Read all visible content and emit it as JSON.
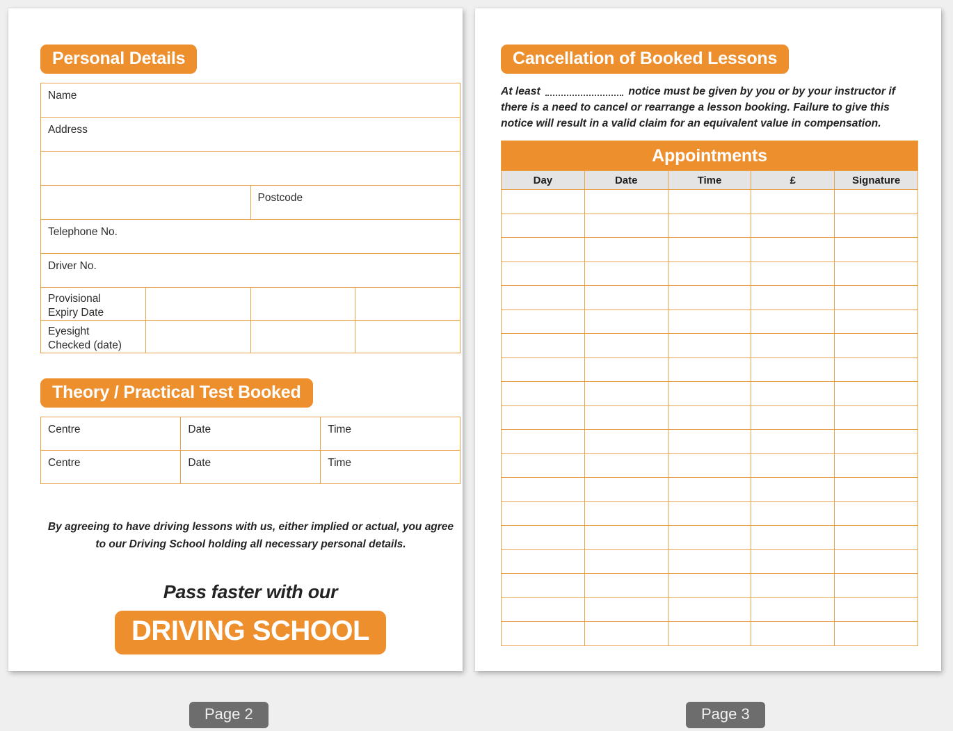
{
  "page_left": {
    "personal_details": {
      "heading": "Personal Details",
      "rows": {
        "name": "Name",
        "address": "Address",
        "postcode": "Postcode",
        "telephone": "Telephone No.",
        "driver_no": "Driver No.",
        "provisional_expiry": "Provisional\nExpiry Date",
        "provisional_expiry_line1": "Provisional",
        "provisional_expiry_line2": "Expiry Date",
        "eyesight_line1": "Eyesight",
        "eyesight_line2": "Checked (date)"
      }
    },
    "theory_test": {
      "heading": "Theory / Practical Test Booked",
      "columns": [
        "Centre",
        "Date",
        "Time"
      ],
      "rows": [
        [
          "Centre",
          "Date",
          "Time"
        ],
        [
          "Centre",
          "Date",
          "Time"
        ]
      ]
    },
    "consent_text": "By agreeing to have driving lessons with us, either implied or actual, you agree to our Driving School holding all necessary personal details.",
    "promo_line": "Pass faster with our",
    "brand_banner": "DRIVING SCHOOL"
  },
  "page_right": {
    "cancellation": {
      "heading": "Cancellation of Booked Lessons",
      "text_before_blank": "At least",
      "text_after_blank": "notice must be given by you or by your instructor if there is a need to cancel or rearrange a lesson booking. Failure to give this notice will result in a valid claim for an equivalent value in compensation."
    },
    "appointments": {
      "title": "Appointments",
      "columns": [
        "Day",
        "Date",
        "Time",
        "£",
        "Signature"
      ],
      "row_count": 19,
      "rows": [
        [
          "",
          "",
          "",
          "",
          ""
        ],
        [
          "",
          "",
          "",
          "",
          ""
        ],
        [
          "",
          "",
          "",
          "",
          ""
        ],
        [
          "",
          "",
          "",
          "",
          ""
        ],
        [
          "",
          "",
          "",
          "",
          ""
        ],
        [
          "",
          "",
          "",
          "",
          ""
        ],
        [
          "",
          "",
          "",
          "",
          ""
        ],
        [
          "",
          "",
          "",
          "",
          ""
        ],
        [
          "",
          "",
          "",
          "",
          ""
        ],
        [
          "",
          "",
          "",
          "",
          ""
        ],
        [
          "",
          "",
          "",
          "",
          ""
        ],
        [
          "",
          "",
          "",
          "",
          ""
        ],
        [
          "",
          "",
          "",
          "",
          ""
        ],
        [
          "",
          "",
          "",
          "",
          ""
        ],
        [
          "",
          "",
          "",
          "",
          ""
        ],
        [
          "",
          "",
          "",
          "",
          ""
        ],
        [
          "",
          "",
          "",
          "",
          ""
        ],
        [
          "",
          "",
          "",
          "",
          ""
        ],
        [
          "",
          "",
          "",
          "",
          ""
        ]
      ]
    }
  },
  "footer": {
    "page_left_label": "Page 2",
    "page_right_label": "Page 3"
  },
  "colors": {
    "accent_orange": "#ee8f2e",
    "table_rule": "#e8a04a",
    "header_grey": "#e4e4e4",
    "page_label_grey": "#6d6d6d",
    "canvas": "#efefef"
  }
}
